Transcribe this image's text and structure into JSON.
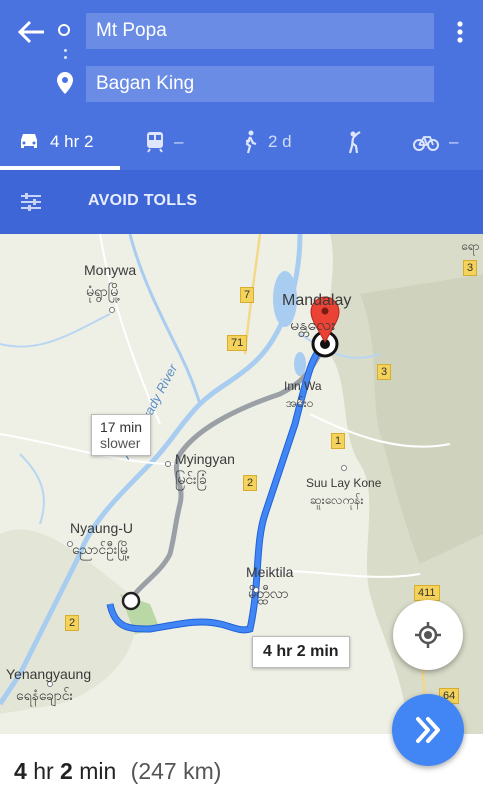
{
  "header": {
    "origin": "Mt Popa",
    "destination": "Bagan King",
    "colors": {
      "bar": "#4a73e0",
      "options_bar": "#3f66d6",
      "route": "#4285f4",
      "alt_route": "#9aa0a6",
      "pin": "#ea4335"
    }
  },
  "modes": [
    {
      "name": "car-icon",
      "label": "4 hr 2",
      "selected": true
    },
    {
      "name": "transit-icon",
      "label": "–"
    },
    {
      "name": "walk-icon",
      "label": "2 d"
    },
    {
      "name": "ride-icon",
      "label": ""
    },
    {
      "name": "bike-icon",
      "label": "–"
    }
  ],
  "options": {
    "avoid_label": "AVOID TOLLS"
  },
  "map": {
    "places": {
      "monywa_en": "Monywa",
      "monywa_my": "မုံရွာမြို့",
      "mandalay_en": "Mandalay",
      "mandalay_my": "မန္တလေး",
      "innwa_en": "Inn Wa",
      "innwa_my": "အင်းဝ",
      "myingyan_en": "Myingyan",
      "myingyan_my": "မြင်းခြံ",
      "suulaykone_en": "Suu Lay Kone",
      "suulaykone_my": "ဆူးလေကုန်း",
      "nyaungu_en": "Nyaung-U",
      "nyaungu_my": "ညောင်ဦးမြို့",
      "meiktila_en": "Meiktila",
      "meiktila_my": "မိတ္ထီလာ",
      "yenangyaung_en": "Yenangyaung",
      "yenangyaung_my": "ရေနံချောင်း",
      "river": "Ayeyarwady River",
      "corner": "ရော"
    },
    "shields": {
      "r7": "7",
      "r71": "71",
      "r3a": "3",
      "r3b": "3",
      "r1": "1",
      "r2a": "2",
      "r2b": "2",
      "r411": "411",
      "r64": "64"
    },
    "alt_callout": {
      "time": "17 min",
      "note": "slower"
    },
    "main_callout": {
      "time": "4 hr 2 min"
    }
  },
  "summary": {
    "hours": "4",
    "hr": "hr",
    "minutes": "2",
    "min": "min",
    "distance": "(247 km)"
  }
}
